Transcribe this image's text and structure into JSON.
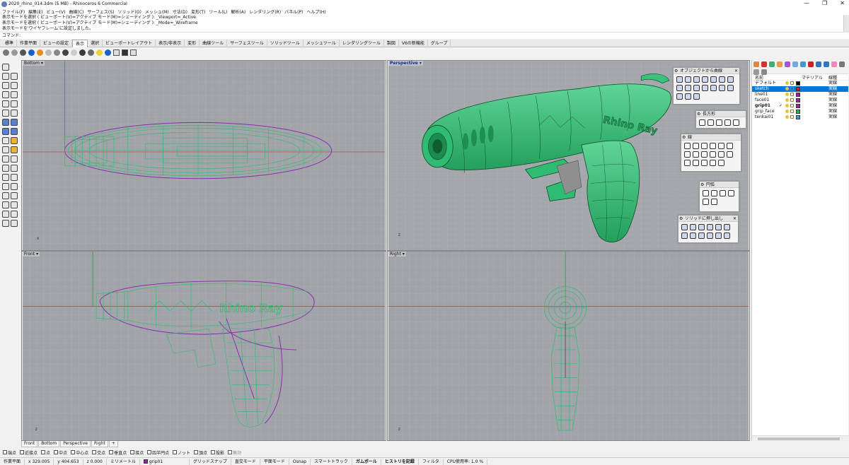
{
  "window": {
    "title": "2020_rhino_014.3dm (5 MB) - Rhinoceros 6 Commercial",
    "controls": [
      "—",
      "❐",
      "✕"
    ]
  },
  "menu": [
    "ファイル(F)",
    "編集(E)",
    "ビュー(V)",
    "曲線(C)",
    "サーフェス(S)",
    "ソリッド(O)",
    "メッシュ(M)",
    "寸法(D)",
    "変形(T)",
    "ツール(L)",
    "解析(A)",
    "レンダリング(R)",
    "パネル(P)",
    "ヘルプ(H)"
  ],
  "command": {
    "history": [
      "表示モードを選択 ( ビューポート(V)=アクティブ  モード(M)=シェーディング ): _Viewport=_Active",
      "表示モードを選択 ( ビューポート(V)=アクティブ  モード(M)=シェーディング ): _Mode=_Wireframe",
      "表示モードを'ワイヤフレーム'に設定しました。"
    ],
    "prompt": "コマンド:"
  },
  "tabs": [
    "標準",
    "作業平面",
    "ビューの設定",
    "表示",
    "選択",
    "ビューポートレイアウト",
    "表示/非表示",
    "変形",
    "曲線ツール",
    "サーフェスツール",
    "ソリッドツール",
    "メッシュツール",
    "レンダリングツール",
    "製図",
    "V6の新機能",
    "グループ"
  ],
  "active_tab": "表示",
  "viewports": {
    "top_left": "Bottom",
    "top_right": "Perspective",
    "bottom_left": "Front",
    "bottom_right": "Right"
  },
  "model_text": "Rhino Ray",
  "panels": {
    "from_object": "オブジェクトから曲線",
    "rectangle": "長方形",
    "line": "線",
    "arc": "円弧",
    "solid_extrude": "ソリッドに押し出し"
  },
  "layers": {
    "header_name": "名前",
    "header_material": "マテリアル",
    "header_linetype": "線種",
    "rows": [
      {
        "name": "デフォルト",
        "color": "#000000",
        "linetype": "実線",
        "current": false,
        "selected": false
      },
      {
        "name": "sketch",
        "color": "#d01c1c",
        "linetype": "実線",
        "current": false,
        "selected": true
      },
      {
        "name": "line01",
        "color": "#9b1faa",
        "linetype": "実線",
        "current": false,
        "selected": false
      },
      {
        "name": "face01",
        "color": "#9b1faa",
        "linetype": "実線",
        "current": false,
        "selected": false
      },
      {
        "name": "grip01",
        "color": "#9b1faa",
        "linetype": "実線",
        "current": true,
        "selected": false
      },
      {
        "name": "grip_face",
        "color": "#27b35a",
        "linetype": "実線",
        "current": false,
        "selected": false
      },
      {
        "name": "tenkai01",
        "color": "#27a7c2",
        "linetype": "実線",
        "current": false,
        "selected": false
      }
    ]
  },
  "viewport_tabs": [
    "Front",
    "Bottom",
    "Perspective",
    "Right",
    "+"
  ],
  "active_viewport_tab": "Right",
  "osnaps": [
    {
      "label": "端点",
      "disabled": false
    },
    {
      "label": "近接点",
      "disabled": false
    },
    {
      "label": "点",
      "disabled": false
    },
    {
      "label": "中点",
      "disabled": false
    },
    {
      "label": "中心点",
      "disabled": false
    },
    {
      "label": "交点",
      "disabled": false
    },
    {
      "label": "垂直点",
      "disabled": false
    },
    {
      "label": "接点",
      "disabled": false
    },
    {
      "label": "四半円点",
      "disabled": false
    },
    {
      "label": "ノット",
      "disabled": false
    },
    {
      "label": "頂点",
      "disabled": false
    },
    {
      "label": "投影",
      "disabled": false
    },
    {
      "label": "無効",
      "disabled": true
    }
  ],
  "status": {
    "cplane": "作業平面",
    "x": "x 329.005",
    "y": "y 404.653",
    "z": "z 0.000",
    "units": "ミリメートル",
    "layer": "grip01",
    "toggles": [
      "グリッドスナップ",
      "直交モード",
      "平面モード",
      "Osnap",
      "スマートトラック",
      "ガムボール",
      "ヒストリを記録",
      "フィルタ"
    ],
    "cpu": "CPU使用率: 1.0 %"
  },
  "colors": {
    "model_green": "#2fbb71",
    "edge_dark": "#0f4a26",
    "viewport_bg": "#a0a4a8",
    "selection_blue": "#0078d7"
  }
}
